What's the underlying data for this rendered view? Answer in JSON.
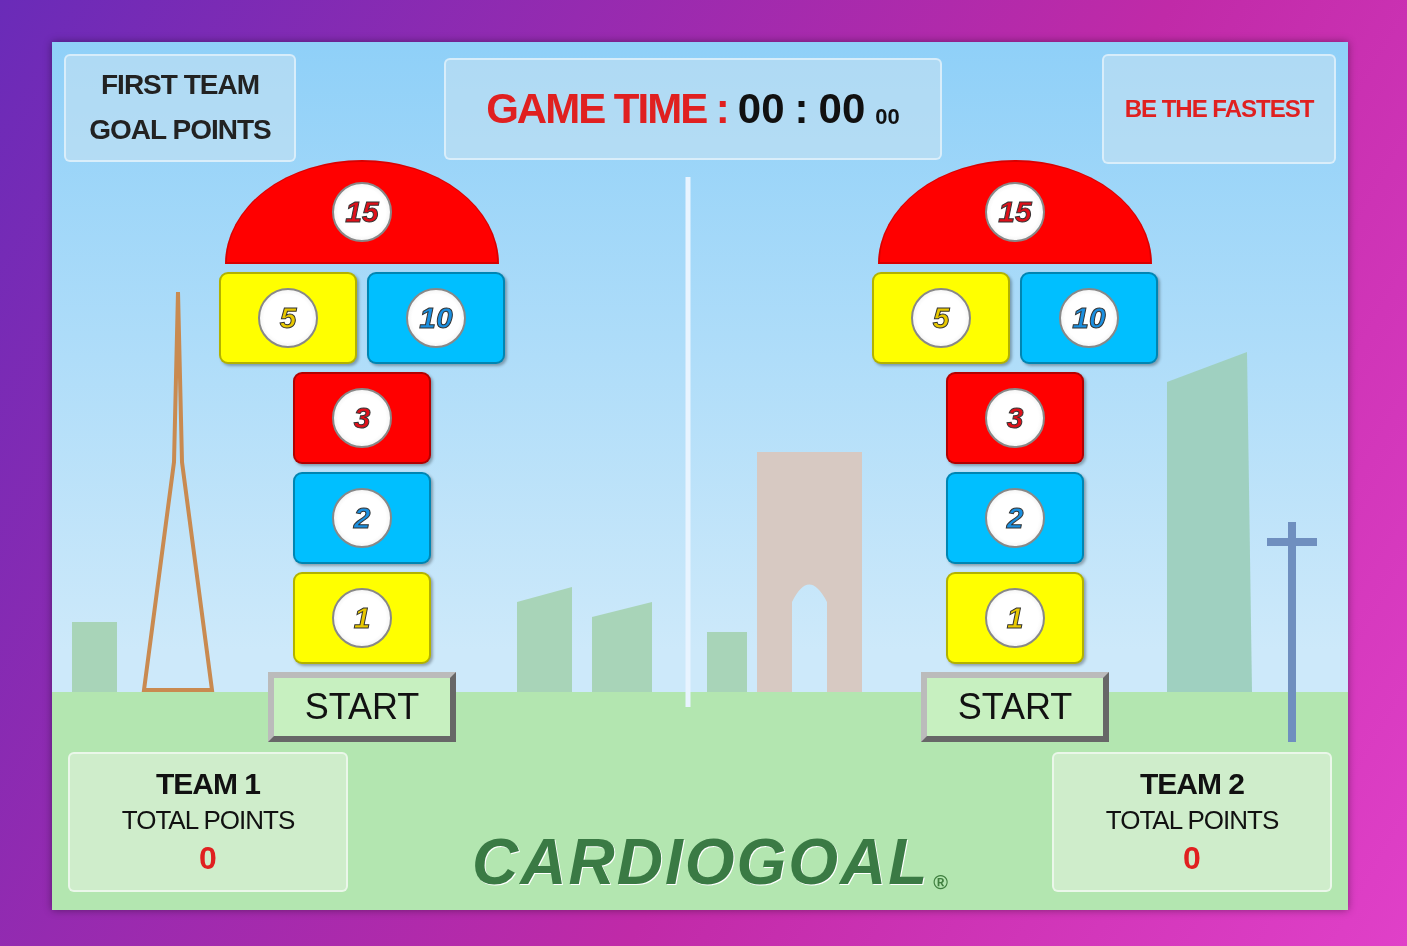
{
  "header": {
    "goal_label": [
      "FIRST TEAM",
      "GOAL POINTS"
    ],
    "game_time": {
      "label": "GAME TIME :",
      "minutes": "00",
      "separator": ":",
      "seconds": "00",
      "hundredths": "00"
    },
    "slogan": "BE THE FASTEST"
  },
  "courts": [
    {
      "rows": [
        [
          {
            "kind": "dome",
            "value": "15",
            "color": "#ff0000"
          }
        ],
        [
          {
            "kind": "tile",
            "value": "5",
            "color": "#ffff00"
          },
          {
            "kind": "tile",
            "value": "10",
            "color": "#00bfff"
          }
        ],
        [
          {
            "kind": "tile",
            "value": "3",
            "color": "#ff0000"
          }
        ],
        [
          {
            "kind": "tile",
            "value": "2",
            "color": "#00bfff"
          }
        ],
        [
          {
            "kind": "tile",
            "value": "1",
            "color": "#ffff00"
          }
        ]
      ],
      "start_button": "START"
    },
    {
      "rows": [
        [
          {
            "kind": "dome",
            "value": "15",
            "color": "#ff0000"
          }
        ],
        [
          {
            "kind": "tile",
            "value": "5",
            "color": "#ffff00"
          },
          {
            "kind": "tile",
            "value": "10",
            "color": "#00bfff"
          }
        ],
        [
          {
            "kind": "tile",
            "value": "3",
            "color": "#ff0000"
          }
        ],
        [
          {
            "kind": "tile",
            "value": "2",
            "color": "#00bfff"
          }
        ],
        [
          {
            "kind": "tile",
            "value": "1",
            "color": "#ffff00"
          }
        ]
      ],
      "start_button": "START"
    }
  ],
  "scoreboards": [
    {
      "team": "TEAM 1",
      "label": "TOTAL POINTS",
      "points": "0"
    },
    {
      "team": "TEAM 2",
      "label": "TOTAL POINTS",
      "points": "0"
    }
  ],
  "logo": {
    "text": "CARDIOGOAL",
    "mark": "®"
  }
}
